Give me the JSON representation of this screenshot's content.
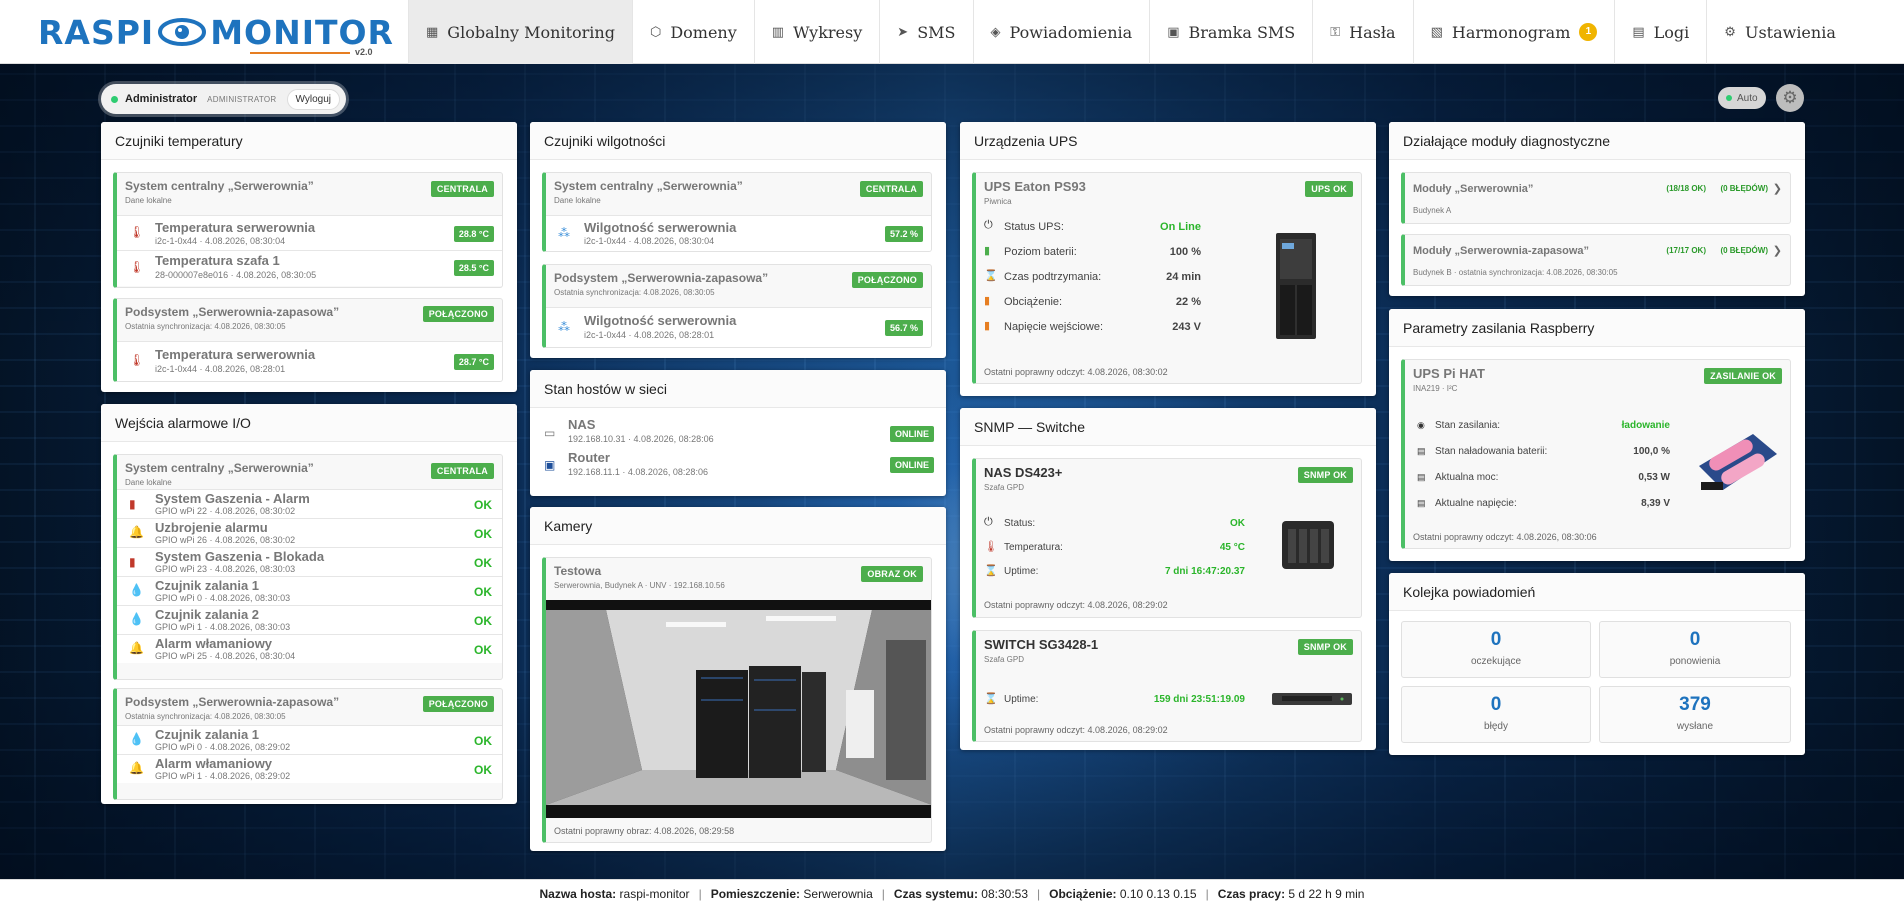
{
  "app": {
    "logo_text_left": "RASPI",
    "logo_text_right": "MONITOR",
    "logo_version": "v2.0"
  },
  "nav": [
    {
      "label": "Globalny Monitoring",
      "icon": "globe-icon",
      "active": true
    },
    {
      "label": "Domeny",
      "icon": "hexagon-icon"
    },
    {
      "label": "Wykresy",
      "icon": "grid-icon"
    },
    {
      "label": "SMS",
      "icon": "send-icon"
    },
    {
      "label": "Powiadomienia",
      "icon": "diamond-icon"
    },
    {
      "label": "Bramka SMS",
      "icon": "square-icon"
    },
    {
      "label": "Hasła",
      "icon": "key-icon"
    },
    {
      "label": "Harmonogram",
      "icon": "calendar-icon",
      "badge": "1"
    },
    {
      "label": "Logi",
      "icon": "list-icon"
    },
    {
      "label": "Ustawienia",
      "icon": "gear-icon"
    }
  ],
  "user": {
    "name": "Administrator",
    "role": "ADMINISTRATOR",
    "logout": "Wyloguj"
  },
  "auto_label": "Auto",
  "temp": {
    "title": "Czujniki temperatury",
    "central": {
      "title": "System centralny „Serwerownia”",
      "sub": "Dane lokalne",
      "tag": "CENTRALA",
      "rows": [
        {
          "name": "Temperatura serwerownia",
          "sub": "i2c-1-0x44 · 4.08.2026, 08:30:04",
          "value": "28.8 °C"
        },
        {
          "name": "Temperatura szafa 1",
          "sub": "28-000007e8e016 · 4.08.2026, 08:30:05",
          "value": "28.5 °C"
        }
      ]
    },
    "sub": {
      "title": "Podsystem „Serwerownia-zapasowa”",
      "sub": "Ostatnia synchronizacja: 4.08.2026, 08:30:05",
      "tag": "POŁĄCZONO",
      "rows": [
        {
          "name": "Temperatura serwerownia",
          "sub": "i2c-1-0x44 · 4.08.2026, 08:28:01",
          "value": "28.7 °C"
        }
      ]
    }
  },
  "alarm": {
    "title": "Wejścia alarmowe I/O",
    "central": {
      "title": "System centralny „Serwerownia”",
      "sub": "Dane lokalne",
      "tag": "CENTRALA",
      "rows": [
        {
          "name": "System Gaszenia - Alarm",
          "sub": "GPIO wPi 22 · 4.08.2026, 08:30:02",
          "value": "OK"
        },
        {
          "name": "Uzbrojenie alarmu",
          "sub": "GPIO wPi 26 · 4.08.2026, 08:30:02",
          "value": "OK"
        },
        {
          "name": "System Gaszenia - Blokada",
          "sub": "GPIO wPi 23 · 4.08.2026, 08:30:03",
          "value": "OK"
        },
        {
          "name": "Czujnik zalania 1",
          "sub": "GPIO wPi 0 · 4.08.2026, 08:30:03",
          "value": "OK"
        },
        {
          "name": "Czujnik zalania 2",
          "sub": "GPIO wPi 1 · 4.08.2026, 08:30:03",
          "value": "OK"
        },
        {
          "name": "Alarm włamaniowy",
          "sub": "GPIO wPi 25 · 4.08.2026, 08:30:04",
          "value": "OK"
        }
      ]
    },
    "sub": {
      "title": "Podsystem „Serwerownia-zapasowa”",
      "sub": "Ostatnia synchronizacja: 4.08.2026, 08:30:05",
      "tag": "POŁĄCZONO",
      "rows": [
        {
          "name": "Czujnik zalania 1",
          "sub": "GPIO wPi 0 · 4.08.2026, 08:29:02",
          "value": "OK"
        },
        {
          "name": "Alarm włamaniowy",
          "sub": "GPIO wPi 1 · 4.08.2026, 08:29:02",
          "value": "OK"
        }
      ]
    }
  },
  "humidity": {
    "title": "Czujniki wilgotności",
    "central": {
      "title": "System centralny „Serwerownia”",
      "sub": "Dane lokalne",
      "tag": "CENTRALA",
      "rows": [
        {
          "name": "Wilgotność serwerownia",
          "sub": "i2c-1-0x44 · 4.08.2026, 08:30:04",
          "value": "57.2 %"
        }
      ]
    },
    "sub": {
      "title": "Podsystem „Serwerownia-zapasowa”",
      "sub": "Ostatnia synchronizacja: 4.08.2026, 08:30:05",
      "tag": "POŁĄCZONO",
      "rows": [
        {
          "name": "Wilgotność serwerownia",
          "sub": "i2c-1-0x44 · 4.08.2026, 08:28:01",
          "value": "56.7 %"
        }
      ]
    }
  },
  "hosts": {
    "title": "Stan hostów w sieci",
    "rows": [
      {
        "name": "NAS",
        "sub": "192.168.10.31 · 4.08.2026, 08:28:06",
        "value": "ONLINE"
      },
      {
        "name": "Router",
        "sub": "192.168.11.1 · 4.08.2026, 08:28:06",
        "value": "ONLINE"
      }
    ]
  },
  "cameras": {
    "title": "Kamery",
    "cam": {
      "title": "Testowa",
      "sub": "Serwerownia, Budynek A · UNV · 192.168.10.56",
      "tag": "OBRAZ OK",
      "foot": "Ostatni poprawny obraz: 4.08.2026, 08:29:58"
    }
  },
  "ups": {
    "title": "Urządzenia UPS",
    "device": {
      "title": "UPS Eaton PS93",
      "sub": "Piwnica",
      "tag": "UPS OK",
      "rows": [
        {
          "label": "Status UPS:",
          "value": "On Line",
          "green": true
        },
        {
          "label": "Poziom baterii:",
          "value": "100 %"
        },
        {
          "label": "Czas podtrzymania:",
          "value": "24 min"
        },
        {
          "label": "Obciążenie:",
          "value": "22 %"
        },
        {
          "label": "Napięcie wejściowe:",
          "value": "243 V"
        }
      ],
      "foot": "Ostatni poprawny odczyt: 4.08.2026, 08:30:02"
    }
  },
  "snmp": {
    "title": "SNMP — Switche",
    "nas": {
      "title": "NAS DS423+",
      "sub": "Szafa GPD",
      "tag": "SNMP OK",
      "rows": [
        {
          "label": "Status:",
          "value": "OK"
        },
        {
          "label": "Temperatura:",
          "value": "45 °C"
        },
        {
          "label": "Uptime:",
          "value": "7 dni 16:47:20.37"
        }
      ],
      "foot": "Ostatni poprawny odczyt: 4.08.2026, 08:29:02"
    },
    "sw": {
      "title": "SWITCH SG3428-1",
      "sub": "Szafa GPD",
      "tag": "SNMP OK",
      "rows": [
        {
          "label": "Uptime:",
          "value": "159 dni 23:51:19.09"
        }
      ],
      "foot": "Ostatni poprawny odczyt: 4.08.2026, 08:29:02"
    }
  },
  "diag": {
    "title": "Działające moduły diagnostyczne",
    "items": [
      {
        "title": "Moduły „Serwerownia”",
        "sub": "Budynek A",
        "count": "(18/18 OK)",
        "errors": "(0 BŁĘDÓW)"
      },
      {
        "title": "Moduły „Serwerownia-zapasowa”",
        "sub": "Budynek B · ostatnia synchronizacja: 4.08.2026, 08:30:05",
        "count": "(17/17 OK)",
        "errors": "(0 BŁĘDÓW)"
      }
    ]
  },
  "power": {
    "title": "Parametry zasilania Raspberry",
    "device": {
      "title": "UPS Pi HAT",
      "sub": "INA219 · I²C",
      "tag": "ZASILANIE OK",
      "rows": [
        {
          "label": "Stan zasilania:",
          "value": "ładowanie"
        },
        {
          "label": "Stan naładowania baterii:",
          "value": "100,0 %"
        },
        {
          "label": "Aktualna moc:",
          "value": "0,53 W"
        },
        {
          "label": "Aktualne napięcie:",
          "value": "8,39 V"
        }
      ],
      "foot": "Ostatni poprawny odczyt: 4.08.2026, 08:30:06"
    }
  },
  "queue": {
    "title": "Kolejka powiadomień",
    "stats": [
      {
        "value": "0",
        "label": "oczekujące"
      },
      {
        "value": "0",
        "label": "ponowienia"
      },
      {
        "value": "0",
        "label": "błędy"
      },
      {
        "value": "379",
        "label": "wysłane"
      }
    ]
  },
  "footer": {
    "host_label": "Nazwa hosta:",
    "host": "raspi-monitor",
    "room_label": "Pomieszczenie:",
    "room": "Serwerownia",
    "time_label": "Czas systemu:",
    "time": "08:30:53",
    "load_label": "Obciążenie:",
    "load": "0.10 0.13 0.15",
    "uptime_label": "Czas pracy:",
    "uptime": "5 d 22 h 9 min"
  },
  "colors": {
    "accent": "#1e73be",
    "ok": "#4cae4c",
    "badge": "#f0b400"
  }
}
